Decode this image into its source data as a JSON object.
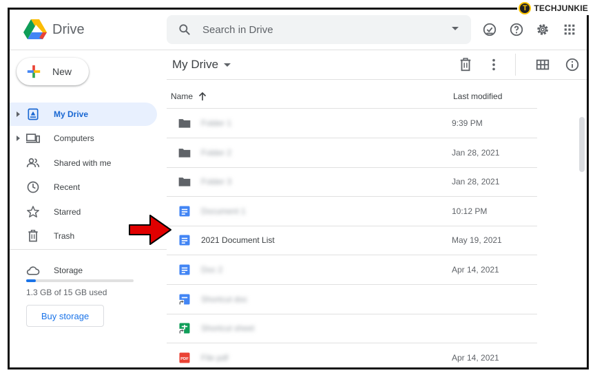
{
  "watermark": {
    "badge": "T",
    "prefix": "TECH",
    "suffix": "JUNKIE"
  },
  "header": {
    "app_name": "Drive",
    "search_placeholder": "Search in Drive",
    "icons": [
      "offline-check-icon",
      "help-icon",
      "settings-icon",
      "apps-grid-icon"
    ]
  },
  "sidebar": {
    "new_label": "New",
    "items": [
      {
        "label": "My Drive",
        "icon": "my-drive-icon",
        "active": true,
        "expandable": true
      },
      {
        "label": "Computers",
        "icon": "computers-icon",
        "active": false,
        "expandable": true
      },
      {
        "label": "Shared with me",
        "icon": "shared-icon",
        "active": false,
        "expandable": false
      },
      {
        "label": "Recent",
        "icon": "clock-icon",
        "active": false,
        "expandable": false
      },
      {
        "label": "Starred",
        "icon": "star-icon",
        "active": false,
        "expandable": false
      },
      {
        "label": "Trash",
        "icon": "trash-icon",
        "active": false,
        "expandable": false
      }
    ],
    "storage": {
      "label": "Storage",
      "usage_text": "1.3 GB of 15 GB used",
      "used_fraction": 0.087,
      "buy_label": "Buy storage"
    }
  },
  "main": {
    "title": "My Drive",
    "columns": {
      "name": "Name",
      "modified": "Last modified"
    },
    "files": [
      {
        "type": "folder",
        "name": "Folder 1",
        "blurred": true,
        "modified": "9:39 PM"
      },
      {
        "type": "folder",
        "name": "Folder 2",
        "blurred": true,
        "modified": "Jan 28, 2021"
      },
      {
        "type": "folder",
        "name": "Folder 3",
        "blurred": true,
        "modified": "Jan 28, 2021"
      },
      {
        "type": "doc",
        "name": "Document 1",
        "blurred": true,
        "modified": "10:12 PM"
      },
      {
        "type": "doc",
        "name": "2021 Document List",
        "blurred": false,
        "modified": "May 19, 2021"
      },
      {
        "type": "doc",
        "name": "Doc 2",
        "blurred": true,
        "modified": "Apr 14, 2021"
      },
      {
        "type": "doc-shortcut",
        "name": "Shortcut doc",
        "blurred": true,
        "modified": ""
      },
      {
        "type": "sheet-shortcut",
        "name": "Shortcut sheet",
        "blurred": true,
        "modified": ""
      },
      {
        "type": "pdf",
        "name": "File pdf",
        "blurred": true,
        "modified": "Apr 14, 2021"
      }
    ]
  },
  "colors": {
    "accent": "#1a73e8",
    "active_bg": "#e8f0fe",
    "doc_blue": "#4285f4",
    "sheet_green": "#0f9d58",
    "pdf_red": "#ea4335",
    "folder_gray": "#5f6368",
    "annotation_arrow": "#e00000"
  }
}
